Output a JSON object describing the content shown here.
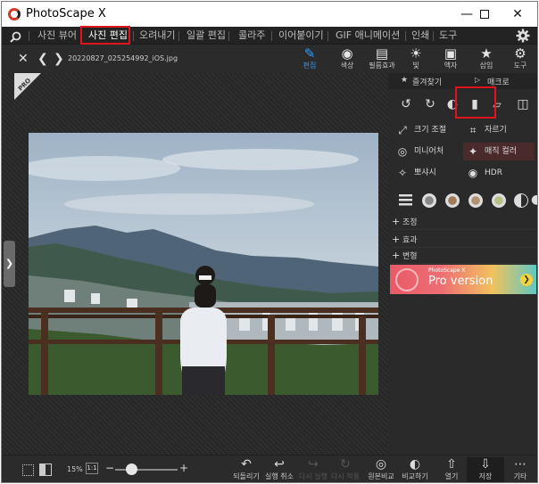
{
  "window": {
    "title": "PhotoScape X"
  },
  "menu": {
    "items": [
      {
        "label": "사진 뷰어"
      },
      {
        "label": "사진 편집"
      },
      {
        "label": "오려내기"
      },
      {
        "label": "일괄 편집"
      },
      {
        "label": "콜라주"
      },
      {
        "label": "이어붙이기"
      },
      {
        "label": "GIF 애니메이션"
      },
      {
        "label": "인쇄"
      },
      {
        "label": "도구"
      }
    ],
    "active": "사진 편집"
  },
  "file": {
    "name": "20220827_025254992_iOS.jpg"
  },
  "toolbar": {
    "tools": [
      {
        "label": "편집",
        "icon": "pencil-icon"
      },
      {
        "label": "색상",
        "icon": "color-circle-icon"
      },
      {
        "label": "필름효과",
        "icon": "film-icon"
      },
      {
        "label": "빛",
        "icon": "light-icon"
      },
      {
        "label": "액자",
        "icon": "frame-icon"
      },
      {
        "label": "삽입",
        "icon": "insert-icon"
      },
      {
        "label": "도구",
        "icon": "tools-icon"
      }
    ]
  },
  "canvas": {
    "pro_badge": "PRO"
  },
  "panel": {
    "favorites_label": "즐겨찾기",
    "macro_label": "매크로",
    "buttons": [
      {
        "label": "크기 조절",
        "icon": "resize-icon"
      },
      {
        "label": "자르기",
        "icon": "crop-icon"
      },
      {
        "label": "미니어처",
        "icon": "miniature-icon"
      },
      {
        "label": "매직 컬러",
        "icon": "magic-color-icon"
      },
      {
        "label": "뽀샤시",
        "icon": "soften-icon"
      },
      {
        "label": "HDR",
        "icon": "hdr-icon"
      }
    ],
    "sections": [
      {
        "label": "조정"
      },
      {
        "label": "효과"
      },
      {
        "label": "변형"
      }
    ],
    "promo": {
      "small": "PhotoScape X",
      "big": "Pro version"
    }
  },
  "bottom": {
    "zoom": "15%",
    "ratio_label": "1:1",
    "zoom_level": 0.25,
    "tools": [
      {
        "label": "되돌리기",
        "icon": "revert-icon"
      },
      {
        "label": "실행 취소",
        "icon": "undo-icon"
      },
      {
        "label": "다시 실행",
        "icon": "redo-icon"
      },
      {
        "label": "다시 적용",
        "icon": "reapply-icon"
      },
      {
        "label": "원본비교",
        "icon": "compare-original-icon"
      },
      {
        "label": "비교하기",
        "icon": "compare-icon"
      },
      {
        "label": "열기",
        "icon": "open-icon"
      },
      {
        "label": "저장",
        "icon": "save-icon"
      },
      {
        "label": "기타",
        "icon": "more-icon"
      }
    ]
  },
  "colors": {
    "accent": "#2f9bff",
    "highlight_box": "#e0141b",
    "background": "#2b2b2b"
  }
}
